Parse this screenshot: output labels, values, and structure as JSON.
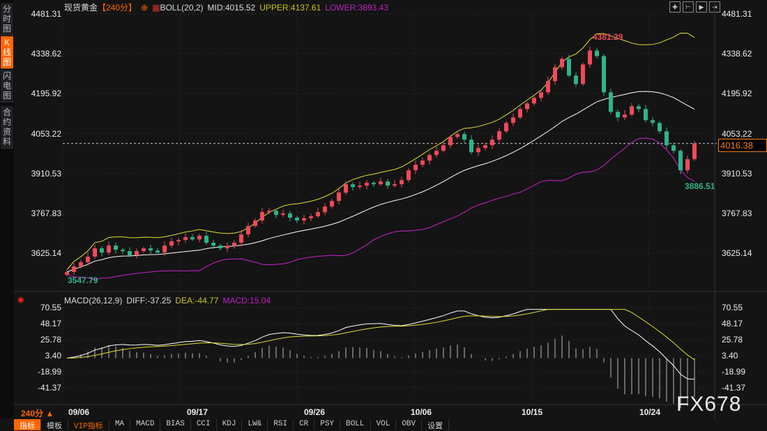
{
  "sidebar": {
    "items": [
      {
        "label": "分时图"
      },
      {
        "label": "K线图",
        "active": true
      },
      {
        "label": "闪电图"
      },
      {
        "label": "合约资料"
      }
    ]
  },
  "header": {
    "symbol": "现货黄金",
    "period": "【240分】",
    "boll": "BOLL(20,2)",
    "mid": "MID:4015.52",
    "upper": "UPPER:4137.61",
    "lower": "LOWER:3893.43"
  },
  "macd_header": {
    "name": "MACD(26,12,9)",
    "diff": "DIFF:-37.25",
    "dea": "DEA:-44.77",
    "macd": "MACD:15.04"
  },
  "toolbar_icons": [
    "crosshair-icon",
    "range-icon",
    "play-icon",
    "exit-icon"
  ],
  "price_axis": [
    "4481.31",
    "4338.62",
    "4195.92",
    "4053.22",
    "3910.53",
    "3767.83",
    "3625.14"
  ],
  "macd_axis": [
    "70.55",
    "48.17",
    "25.78",
    "3.40",
    "-18.99",
    "-41.37"
  ],
  "current_price": "4016.38",
  "annotations": {
    "high": "4381.29",
    "low_start": "3547.79",
    "low_recent": "3886.51"
  },
  "dates": [
    "09/06",
    "09/17",
    "09/26",
    "10/06",
    "10/15",
    "10/24"
  ],
  "period_selector": "240分 ▲",
  "bottom_tabs": [
    "指标",
    "模板",
    "VIP指标",
    "MA",
    "MACD",
    "BIAS",
    "CCI",
    "KDJ",
    "LW&",
    "RSI",
    "CR",
    "PSY",
    "BOLL",
    "VOL",
    "OBV",
    "设置"
  ],
  "watermark": "FX678",
  "colors": {
    "up": "#f04a5a",
    "down": "#2fb38a",
    "mid": "#ffffff",
    "upper": "#e0e030",
    "lower": "#d020d0",
    "accent": "#ff6600"
  },
  "chart_data": {
    "type": "candlestick",
    "ylim": [
      3547.79,
      4481.31
    ],
    "macd_ylim": [
      -70,
      70.55
    ],
    "closes": [
      3555,
      3575,
      3590,
      3610,
      3640,
      3625,
      3650,
      3635,
      3630,
      3615,
      3630,
      3640,
      3632,
      3625,
      3650,
      3665,
      3670,
      3680,
      3672,
      3685,
      3660,
      3650,
      3640,
      3648,
      3660,
      3690,
      3720,
      3740,
      3770,
      3775,
      3760,
      3765,
      3750,
      3740,
      3748,
      3755,
      3770,
      3790,
      3810,
      3840,
      3870,
      3860,
      3865,
      3875,
      3870,
      3880,
      3865,
      3870,
      3885,
      3920,
      3940,
      3955,
      3975,
      3990,
      4010,
      4040,
      4050,
      4030,
      3985,
      4000,
      4010,
      4030,
      4060,
      4090,
      4110,
      4140,
      4160,
      4180,
      4200,
      4240,
      4290,
      4320,
      4260,
      4230,
      4300,
      4350,
      4330,
      4200,
      4130,
      4110,
      4120,
      4150,
      4140,
      4100,
      4090,
      4060,
      4010,
      3990,
      3920,
      3960,
      4016.38
    ]
  }
}
